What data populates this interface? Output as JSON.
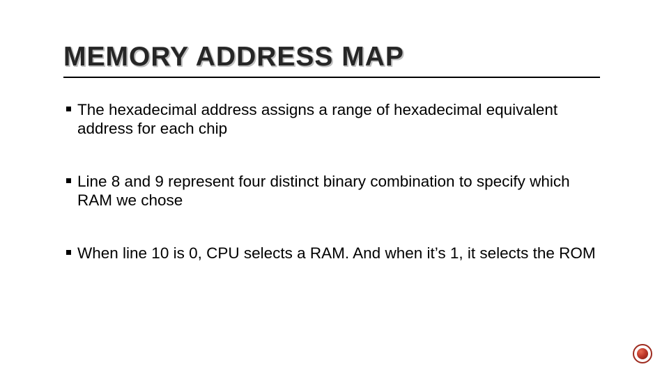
{
  "title": "MEMORY ADDRESS MAP",
  "bullets": [
    "The hexadecimal address assigns a range of hexadecimal equivalent address for each chip",
    "Line 8 and 9 represent four distinct binary combination to specify which RAM we chose",
    "When line 10 is 0, CPU selects a RAM. And when it’s 1, it selects the ROM"
  ]
}
